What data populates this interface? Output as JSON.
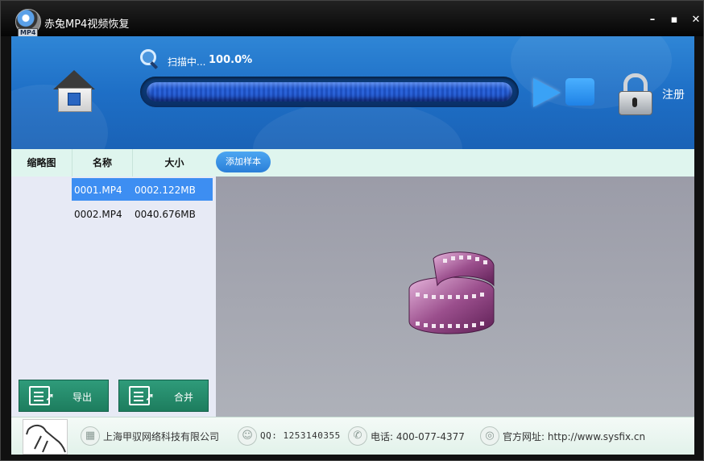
{
  "window": {
    "title": "赤兔MP4视频恢复",
    "logo_tag": "MP4",
    "minimize": "–",
    "maximize": "▪",
    "close": "✕"
  },
  "scan": {
    "label": "扫描中...",
    "percent_text": "100.0%",
    "progress": 1.0,
    "register_label": "注册"
  },
  "list": {
    "columns": [
      "缩略图",
      "名称",
      "大小"
    ],
    "files": [
      {
        "name": "0001.MP4",
        "size": "0002.122MB",
        "selected": true
      },
      {
        "name": "0002.MP4",
        "size": "0040.676MB",
        "selected": false
      }
    ]
  },
  "toolbar": {
    "add_sample_label": "添加样本"
  },
  "actions": {
    "export_label": "导出",
    "merge_label": "合并"
  },
  "footer": {
    "company": "上海甲驭网络科技有限公司",
    "qq": "QQ: 1253140355",
    "phone": "电话: 400-077-4377",
    "website": "官方网址: http://www.sysfix.cn"
  },
  "colors": {
    "header_blue": "#1e6fc6",
    "selection_blue": "#3d8ef2",
    "action_green": "#1d7d5e"
  }
}
